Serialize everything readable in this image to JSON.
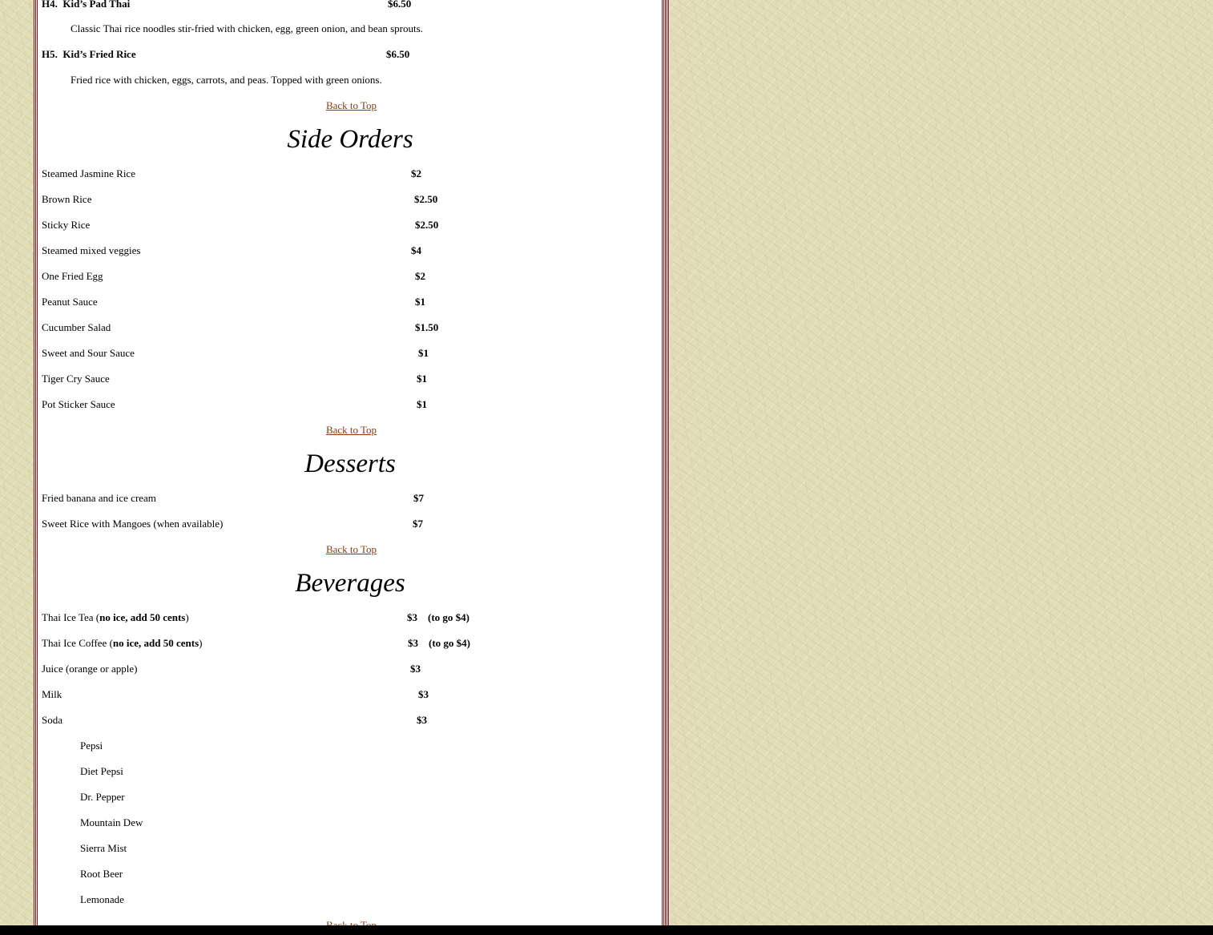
{
  "kids": {
    "items": [
      {
        "code": "H4.",
        "name": "Kid’s Pad Thai",
        "price": "$6.50",
        "desc": "Classic Thai rice noodles stir-fried with chicken, egg, green onion, and bean sprouts."
      },
      {
        "code": "H5.",
        "name": "Kid’s Fried Rice",
        "price": "$6.50",
        "desc": "Fried rice with chicken, eggs, carrots, and peas. Topped with green onions."
      }
    ]
  },
  "back_to_top_label": "Back to Top",
  "side_orders": {
    "title": "Side Orders",
    "items": [
      {
        "name": "Steamed Jasmine Rice",
        "price": "$2"
      },
      {
        "name": "Brown Rice",
        "price": "$2.50"
      },
      {
        "name": "Sticky Rice",
        "price": "$2.50"
      },
      {
        "name": "Steamed mixed veggies",
        "price": "$4"
      },
      {
        "name": "One Fried Egg",
        "price": "$2"
      },
      {
        "name": "Peanut Sauce",
        "price": "$1"
      },
      {
        "name": "Cucumber Salad",
        "price": "$1.50"
      },
      {
        "name": "Sweet and Sour Sauce",
        "price": "$1"
      },
      {
        "name": "Tiger Cry Sauce",
        "price": "$1"
      },
      {
        "name": "Pot Sticker Sauce",
        "price": "$1"
      }
    ]
  },
  "desserts": {
    "title": "Desserts",
    "items": [
      {
        "name": "Fried banana and ice cream",
        "price": "$7"
      },
      {
        "name": "Sweet Rice with Mangoes (when available)",
        "price": "$7"
      }
    ]
  },
  "beverages": {
    "title": "Beverages",
    "items": [
      {
        "name": "Thai Ice Tea (",
        "note": "no ice, add 50 cents",
        "close": ")",
        "price": "$3",
        "togo": "(to go $4)"
      },
      {
        "name": "Thai Ice Coffee (",
        "note": "no ice, add 50 cents",
        "close": ")",
        "price": "$3",
        "togo": "(to go $4)"
      },
      {
        "name": "Juice (orange or apple)",
        "price": "$3"
      },
      {
        "name": "Milk",
        "price": "$3"
      },
      {
        "name": "Soda",
        "price": "$3"
      }
    ],
    "sodas": [
      "Pepsi",
      "Diet Pepsi",
      "Dr. Pepper",
      "Mountain Dew",
      "Sierra Mist",
      "Root Beer",
      "Lemonade"
    ]
  }
}
